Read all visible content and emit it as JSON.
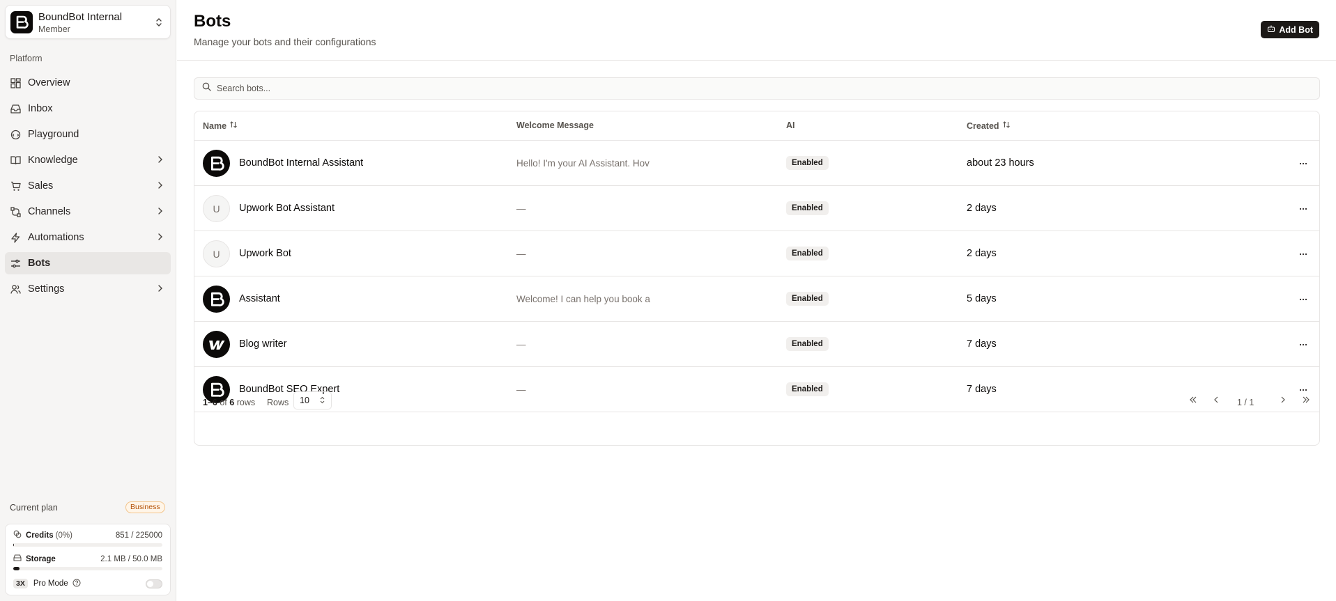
{
  "workspace": {
    "name": "BoundBot Internal",
    "role": "Member"
  },
  "sidebar": {
    "section_label": "Platform",
    "items": [
      {
        "label": "Overview",
        "icon": "grid-icon"
      },
      {
        "label": "Inbox",
        "icon": "inbox-icon"
      },
      {
        "label": "Playground",
        "icon": "chat-icon"
      },
      {
        "label": "Knowledge",
        "icon": "book-icon"
      },
      {
        "label": "Sales",
        "icon": "cart-icon"
      },
      {
        "label": "Channels",
        "icon": "channels-icon"
      },
      {
        "label": "Automations",
        "icon": "bolt-icon"
      },
      {
        "label": "Bots",
        "icon": "sliders-icon"
      },
      {
        "label": "Settings",
        "icon": "users-icon"
      }
    ],
    "plan": {
      "label": "Current plan",
      "badge": "Business",
      "credits": {
        "label": "Credits",
        "pct": "(0%)",
        "value": "851 / 225000",
        "fraction": 0.004
      },
      "storage": {
        "label": "Storage",
        "value": "2.1 MB / 50.0 MB",
        "fraction": 0.042
      },
      "pro": {
        "chip": "3X",
        "label": "Pro Mode",
        "enabled": false
      }
    }
  },
  "header": {
    "title": "Bots",
    "subtitle": "Manage your bots and their configurations",
    "add_button": "Add Bot"
  },
  "search": {
    "placeholder": "Search bots..."
  },
  "table": {
    "columns": {
      "name": "Name",
      "welcome": "Welcome Message",
      "ai": "AI",
      "created": "Created"
    },
    "rows": [
      {
        "name": "BoundBot Internal Assistant",
        "welcome": "Hello! I'm your AI Assistant. Hov",
        "ai": "Enabled",
        "created": "about 23 hours",
        "avatar": "B"
      },
      {
        "name": "Upwork Bot Assistant",
        "welcome": "—",
        "ai": "Enabled",
        "created": "2 days",
        "avatar": "U"
      },
      {
        "name": "Upwork Bot",
        "welcome": "—",
        "ai": "Enabled",
        "created": "2 days",
        "avatar": "U"
      },
      {
        "name": "Assistant",
        "welcome": "Welcome! I can help you book a",
        "ai": "Enabled",
        "created": "5 days",
        "avatar": "B"
      },
      {
        "name": "Blog writer",
        "welcome": "—",
        "ai": "Enabled",
        "created": "7 days",
        "avatar": "W"
      },
      {
        "name": "BoundBot SEO Expert",
        "welcome": "—",
        "ai": "Enabled",
        "created": "7 days",
        "avatar": "B"
      }
    ]
  },
  "pagination": {
    "range": "1–6",
    "of": "of",
    "total": "6",
    "rows_word": "rows",
    "rows_label": "Rows",
    "rows_per_page": "10",
    "page_info": "1 / 1"
  },
  "colors": {
    "accent": "#1c1917",
    "badge_bg": "#f1efed",
    "plan_badge": "#b45309"
  }
}
